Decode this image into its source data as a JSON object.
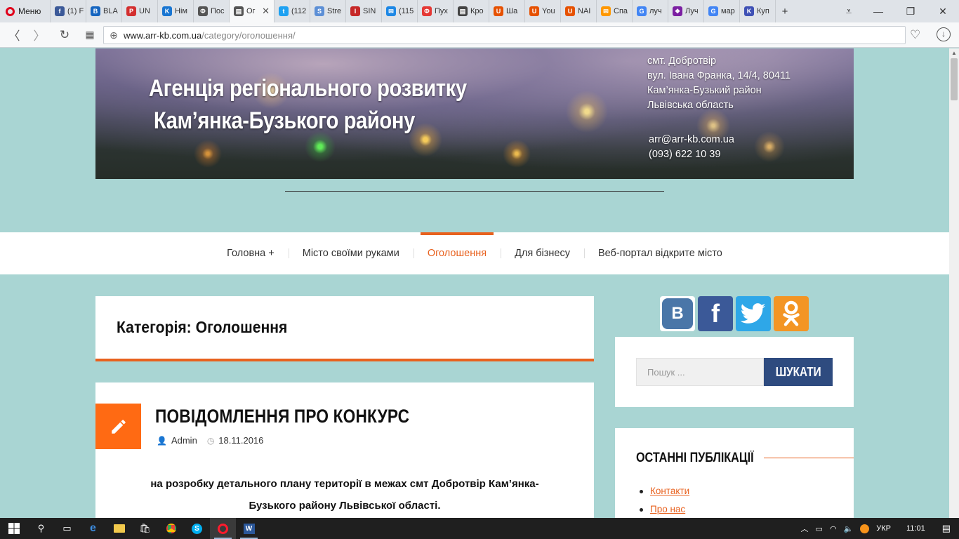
{
  "browser": {
    "menu_label": "Меню",
    "tabs": [
      {
        "label": "(1) F",
        "color": "#3b5998",
        "glyph": "f"
      },
      {
        "label": "BLA",
        "color": "#1565c0",
        "glyph": "B"
      },
      {
        "label": "UN",
        "color": "#d32f2f",
        "glyph": "P"
      },
      {
        "label": "Нім",
        "color": "#1976d2",
        "glyph": "K"
      },
      {
        "label": "Пос",
        "color": "#555555",
        "glyph": "Ф"
      },
      {
        "label": "Ог",
        "color": "#555555",
        "glyph": "▤",
        "active": true
      },
      {
        "label": "(112",
        "color": "#1da1f2",
        "glyph": "t"
      },
      {
        "label": "Stre",
        "color": "#5c8fd6",
        "glyph": "S"
      },
      {
        "label": "SIN",
        "color": "#c62828",
        "glyph": "I"
      },
      {
        "label": "(115",
        "color": "#1e88e5",
        "glyph": "✉"
      },
      {
        "label": "Пух",
        "color": "#e53935",
        "glyph": "Ф"
      },
      {
        "label": "Кро",
        "color": "#444444",
        "glyph": "▤"
      },
      {
        "label": "Ша",
        "color": "#e65100",
        "glyph": "U"
      },
      {
        "label": "You",
        "color": "#e65100",
        "glyph": "U"
      },
      {
        "label": "NAI",
        "color": "#e65100",
        "glyph": "U"
      },
      {
        "label": "Спа",
        "color": "#ff9800",
        "glyph": "✉"
      },
      {
        "label": "луч",
        "color": "#4285f4",
        "glyph": "G"
      },
      {
        "label": "Луч",
        "color": "#7b1fa2",
        "glyph": "❖"
      },
      {
        "label": "мар",
        "color": "#4285f4",
        "glyph": "G"
      },
      {
        "label": "Куп",
        "color": "#3f51b5",
        "glyph": "K"
      }
    ],
    "url_host": "www.arr-kb.com.ua",
    "url_path": "/category/оголошення/"
  },
  "header": {
    "title_line1": "Агенція регіонального розвитку",
    "title_line2": "Кам’янка-Бузького району",
    "address_lines": [
      "смт. Добротвір",
      "вул. Івана Франка, 14/4, 80411",
      "Кам’янка-Бузький район",
      "Львівська область"
    ],
    "email": "arr@arr-kb.com.ua",
    "phone": "(093) 622 10 39"
  },
  "nav": {
    "items": [
      {
        "label": "Головна +"
      },
      {
        "label": "Місто своїми руками"
      },
      {
        "label": "Оголошення",
        "current": true
      },
      {
        "label": "Для бізнесу"
      },
      {
        "label": "Веб-портал відкрите місто"
      }
    ]
  },
  "category": {
    "title": "Категорія: Оголошення"
  },
  "post": {
    "title": "ПОВІДОМЛЕННЯ ПРО КОНКУРС",
    "author": "Admin",
    "date": "18.11.2016",
    "excerpt_line1": "на розробку детального плану території в межах смт Добротвір Кам’янка-",
    "excerpt_line2": "Бузького району Львівської області."
  },
  "sidebar": {
    "social": [
      {
        "name": "vk",
        "glyph": "B",
        "color": "#4a76a8"
      },
      {
        "name": "facebook",
        "glyph": "f",
        "color": "#3b5998"
      },
      {
        "name": "twitter",
        "glyph": "🐦",
        "color": "#2ea7e8"
      },
      {
        "name": "odnoklassniki",
        "glyph": "ок",
        "color": "#f39524"
      }
    ],
    "search_placeholder": "Пошук ...",
    "search_button": "ШУКАТИ",
    "recent_heading": "ОСТАННІ ПУБЛІКАЦІЇ",
    "recent_items": [
      {
        "label": "Контакти"
      },
      {
        "label": "Про нас"
      }
    ]
  },
  "taskbar": {
    "language": "УКР",
    "time": "11:01"
  },
  "colors": {
    "accent": "#e8611e",
    "page_bg": "#a9d5d3",
    "search_button": "#2e4b7f"
  }
}
